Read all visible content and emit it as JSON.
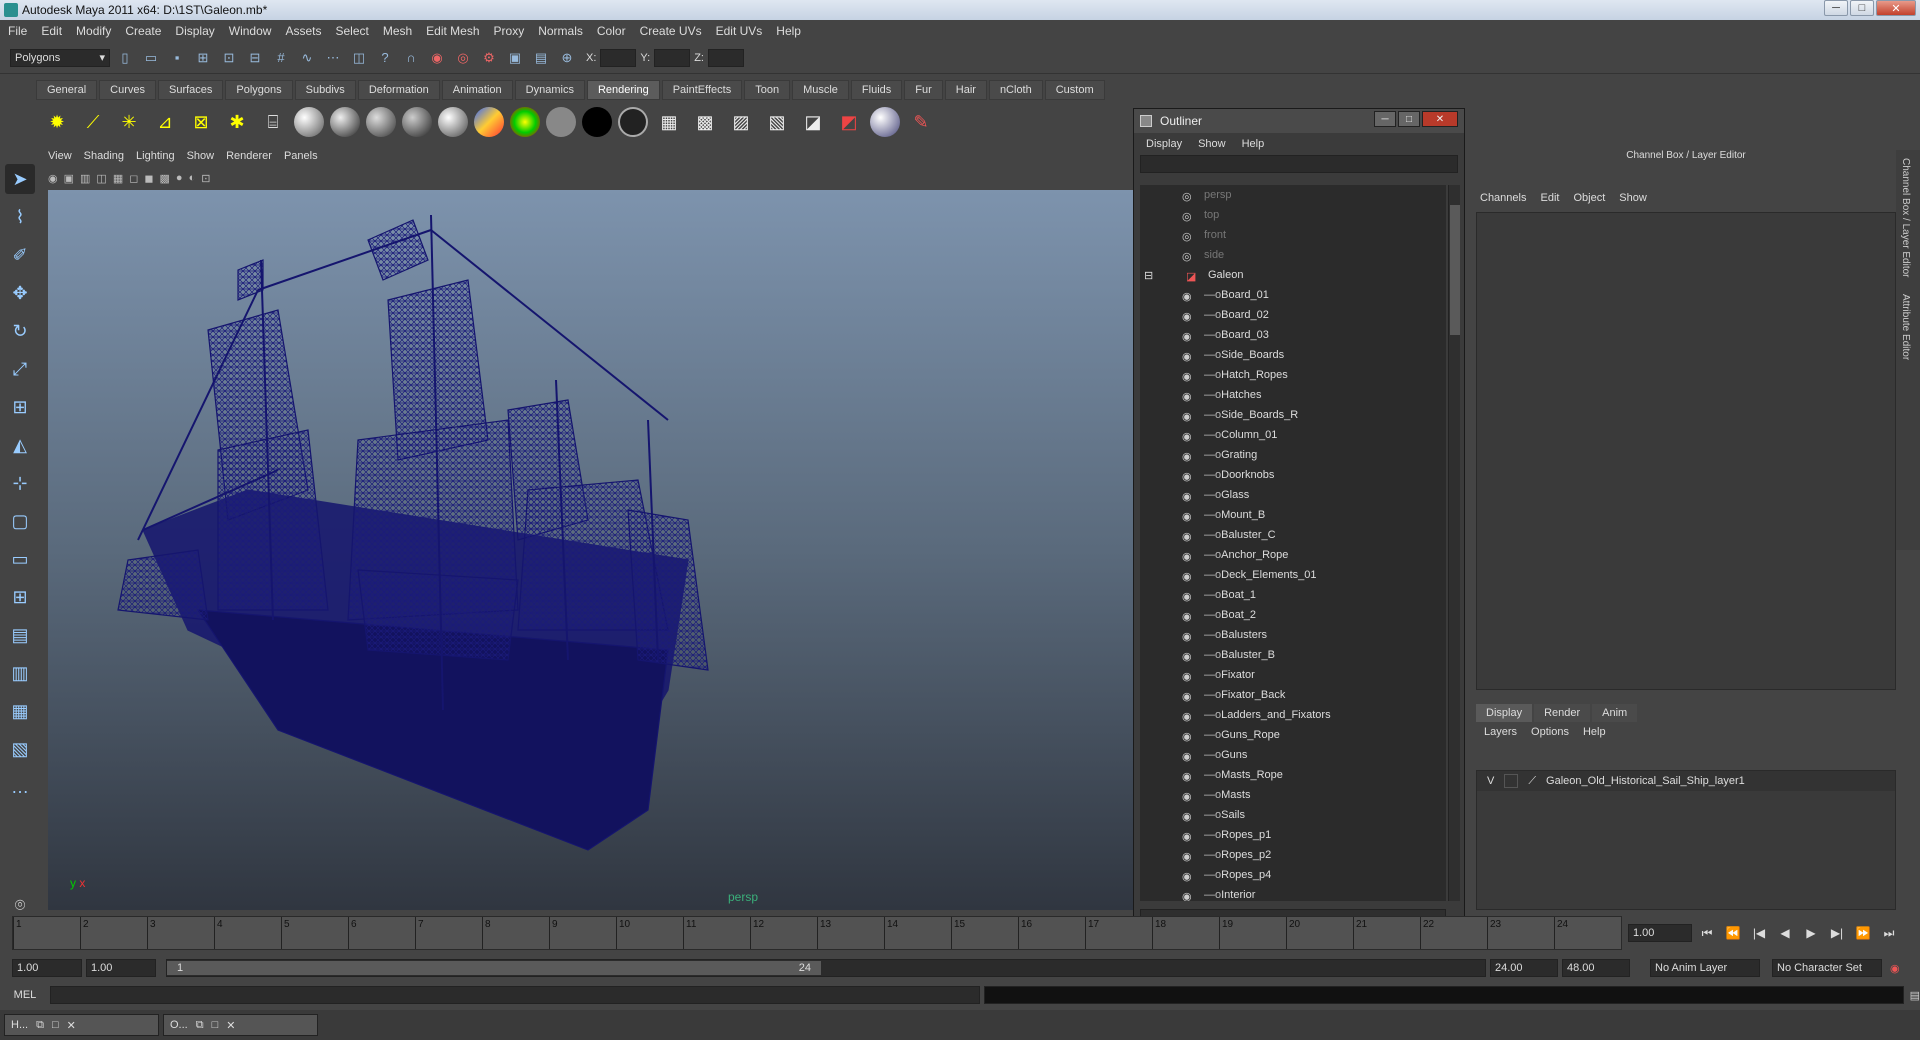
{
  "window": {
    "title": "Autodesk Maya 2011 x64: D:\\1ST\\Galeon.mb*",
    "min": "─",
    "max": "□",
    "close": "✕"
  },
  "menubar": [
    "File",
    "Edit",
    "Modify",
    "Create",
    "Display",
    "Window",
    "Assets",
    "Select",
    "Mesh",
    "Edit Mesh",
    "Proxy",
    "Normals",
    "Color",
    "Create UVs",
    "Edit UVs",
    "Help"
  ],
  "status": {
    "mode": "Polygons",
    "x_label": "X:",
    "y_label": "Y:",
    "z_label": "Z:"
  },
  "shelf_tabs": [
    "General",
    "Curves",
    "Surfaces",
    "Polygons",
    "Subdivs",
    "Deformation",
    "Animation",
    "Dynamics",
    "Rendering",
    "PaintEffects",
    "Toon",
    "Muscle",
    "Fluids",
    "Fur",
    "Hair",
    "nCloth",
    "Custom"
  ],
  "shelf_active": "Rendering",
  "viewport": {
    "menu": [
      "View",
      "Shading",
      "Lighting",
      "Show",
      "Renderer",
      "Panels"
    ],
    "camera_label": "persp",
    "axis_y": "y",
    "axis_x": "x"
  },
  "outliner": {
    "title": "Outliner",
    "menu": [
      "Display",
      "Show",
      "Help"
    ],
    "cameras": [
      "persp",
      "top",
      "front",
      "side"
    ],
    "group": "Galeon",
    "children": [
      "Board_01",
      "Board_02",
      "Board_03",
      "Side_Boards",
      "Hatch_Ropes",
      "Hatches",
      "Side_Boards_R",
      "Column_01",
      "Grating",
      "Doorknobs",
      "Glass",
      "Mount_B",
      "Baluster_C",
      "Anchor_Rope",
      "Deck_Elements_01",
      "Boat_1",
      "Boat_2",
      "Balusters",
      "Baluster_B",
      "Fixator",
      "Fixator_Back",
      "Ladders_and_Fixators",
      "Guns_Rope",
      "Guns",
      "Masts_Rope",
      "Masts",
      "Sails",
      "Ropes_p1",
      "Ropes_p2",
      "Ropes_p4",
      "Interior"
    ]
  },
  "channel_box": {
    "title": "Channel Box / Layer Editor",
    "menu": [
      "Channels",
      "Edit",
      "Object",
      "Show"
    ],
    "side_tabs": [
      "Channel Box / Layer Editor",
      "Attribute Editor"
    ]
  },
  "layer_editor": {
    "tabs": [
      "Display",
      "Render",
      "Anim"
    ],
    "active": "Display",
    "menu": [
      "Layers",
      "Options",
      "Help"
    ],
    "layers": [
      {
        "visible": "V",
        "name": "Galeon_Old_Historical_Sail_Ship_layer1"
      }
    ]
  },
  "timeline": {
    "ticks": [
      "1",
      "2",
      "3",
      "4",
      "5",
      "6",
      "7",
      "8",
      "9",
      "10",
      "11",
      "12",
      "13",
      "14",
      "15",
      "16",
      "17",
      "18",
      "19",
      "20",
      "21",
      "22",
      "23",
      "24"
    ],
    "current_frame": "1.00",
    "frame_marker": "1"
  },
  "range": {
    "start": "1.00",
    "playback_start": "1.00",
    "slider_start": "1",
    "slider_end": "24",
    "playback_end": "24.00",
    "end": "48.00",
    "anim_layer": "No Anim Layer",
    "character_set": "No Character Set"
  },
  "command_line": {
    "label": "MEL"
  },
  "taskbar": [
    {
      "label": "H..."
    },
    {
      "label": "O..."
    }
  ]
}
